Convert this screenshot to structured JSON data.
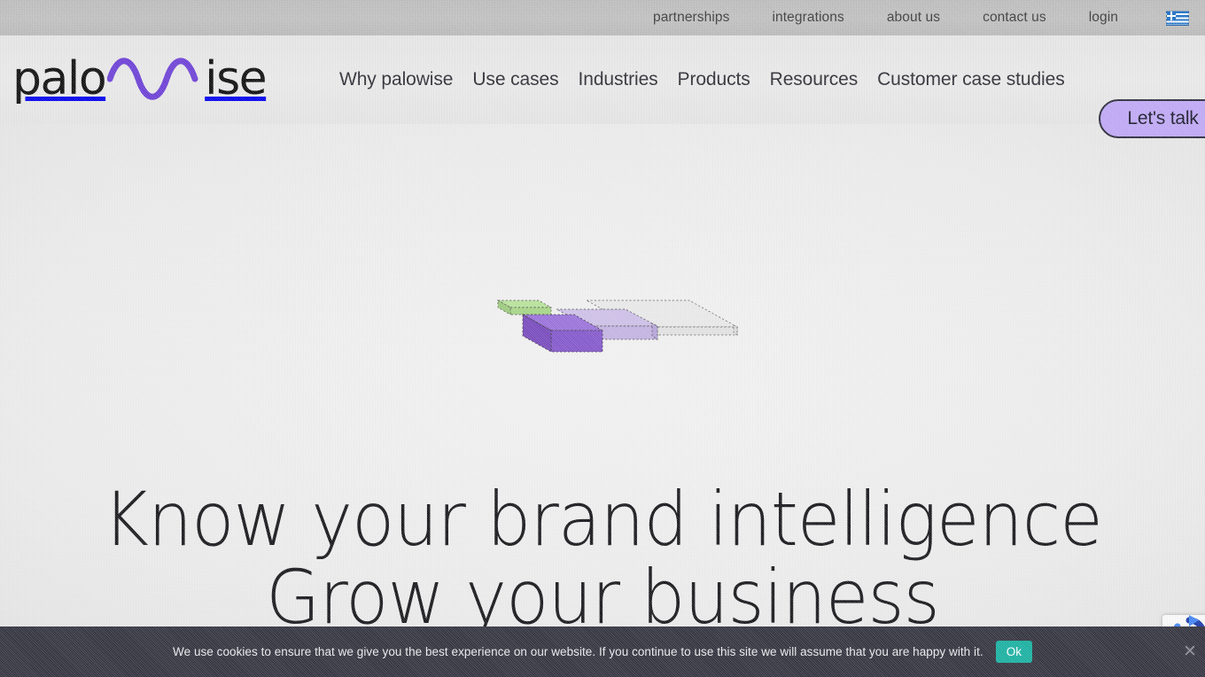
{
  "topbar": {
    "links": [
      {
        "label": "partnerships"
      },
      {
        "label": "integrations"
      },
      {
        "label": "about us"
      },
      {
        "label": "contact us"
      },
      {
        "label": "login"
      }
    ],
    "language_flag": "greek-flag-icon"
  },
  "header": {
    "logo": {
      "text_before": "palo",
      "text_after": "ise",
      "wave_icon": "sine-wave-icon",
      "wave_color": "#6c3fd6"
    },
    "nav": [
      {
        "label": "Why palowise"
      },
      {
        "label": "Use cases"
      },
      {
        "label": "Industries"
      },
      {
        "label": "Products"
      },
      {
        "label": "Resources"
      },
      {
        "label": "Customer case studies"
      }
    ],
    "cta": {
      "label": "Let's talk",
      "fill": "#bfa8f5",
      "border": "#2b2b3b"
    }
  },
  "hero": {
    "art": {
      "name": "isometric-blocks-illustration",
      "blocks": [
        {
          "name": "green-slab",
          "color": "#b8e39a"
        },
        {
          "name": "dark-purple-block",
          "color": "#8458cc"
        },
        {
          "name": "light-purple-block",
          "color": "#cec0e8"
        },
        {
          "name": "empty-dashed-slab",
          "color": "#e8e8e8"
        }
      ]
    },
    "headline_line1": "Know your brand intelligence",
    "headline_line2": "Grow your business"
  },
  "recaptcha": {
    "name": "recaptcha-badge"
  },
  "cookiebar": {
    "message": "We use cookies to ensure that we give you the best experience on our website. If you continue to use this site we will assume that you are happy with it.",
    "ok_label": "Ok",
    "ok_color": "#17b0a0",
    "close_icon": "close-icon",
    "background": "#32323e"
  }
}
